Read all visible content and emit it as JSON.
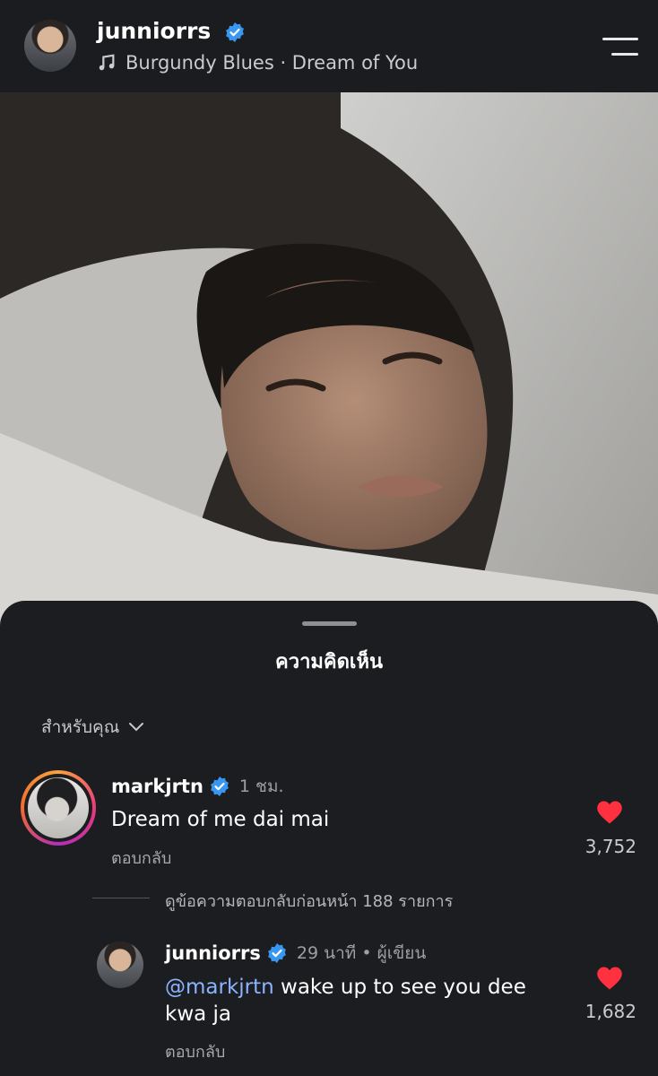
{
  "header": {
    "username": "junniorrs",
    "music": "Burgundy Blues · Dream of You"
  },
  "sheet": {
    "title": "ความคิดเห็น",
    "filter_label": "สำหรับคุณ"
  },
  "comments": [
    {
      "username": "markjrtn",
      "time": "1 ชม.",
      "text": "Dream of me dai mai",
      "reply_label": "ตอบกลับ",
      "likes": "3,752"
    }
  ],
  "view_previous_replies": "ดูข้อความตอบกลับก่อนหน้า 188 รายการ",
  "replies": [
    {
      "username": "junniorrs",
      "meta": "29 นาที • ผู้เขียน",
      "mention": "@markjrtn",
      "text": " wake up to see you dee kwa ja",
      "reply_label": "ตอบกลับ",
      "likes": "1,682"
    }
  ],
  "colors": {
    "verified": "#3897f0",
    "heart": "#ff3040",
    "mention": "#8ab4ff"
  }
}
